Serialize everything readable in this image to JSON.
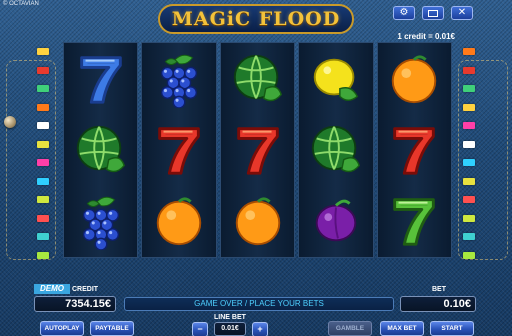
{
  "brand": "© OCTAVIAN",
  "title": "MAGiC FLOOD",
  "credit_rate": "1 credit = 0.01€",
  "top_buttons": [
    {
      "name": "settings",
      "icon": "gear-icon"
    },
    {
      "name": "minimize",
      "icon": "minimize-icon"
    },
    {
      "name": "close",
      "icon": "close-icon"
    }
  ],
  "line_colors_left": [
    "#ffd23f",
    "#e83a2e",
    "#3fd07a",
    "#ff7a1a",
    "#ffffff",
    "#e8e23f",
    "#ff3fa8",
    "#2fd0ff",
    "#cfe83f",
    "#ff5050",
    "#3fd0d0",
    "#a8e83f"
  ],
  "line_colors_right": [
    "#ff7a1a",
    "#e83a2e",
    "#3fd07a",
    "#ffd23f",
    "#ff3fa8",
    "#ffffff",
    "#2fd0ff",
    "#e8e23f",
    "#ff5050",
    "#cfe83f",
    "#3fd0d0",
    "#a8e83f"
  ],
  "reels": [
    [
      "seven-blue",
      "watermelon",
      "grapes"
    ],
    [
      "grapes",
      "seven-red",
      "orange"
    ],
    [
      "watermelon",
      "seven-red",
      "orange"
    ],
    [
      "lemon",
      "watermelon",
      "plum"
    ],
    [
      "orange",
      "seven-red",
      "seven-green"
    ]
  ],
  "demo_label": "DEMO",
  "credit_label": "CREDIT",
  "credit_value": "7354.15€",
  "message": "GAME OVER / PLACE YOUR BETS",
  "bet_label": "BET",
  "bet_value": "0.10€",
  "line_bet_label": "LINE BET",
  "line_bet_value": "0.01€",
  "buttons": {
    "autoplay": "AUTOPLAY",
    "paytable": "PAYTABLE",
    "minus": "−",
    "plus": "+",
    "gamble": "GAMBLE",
    "max_bet": "MAX BET",
    "start": "START"
  }
}
